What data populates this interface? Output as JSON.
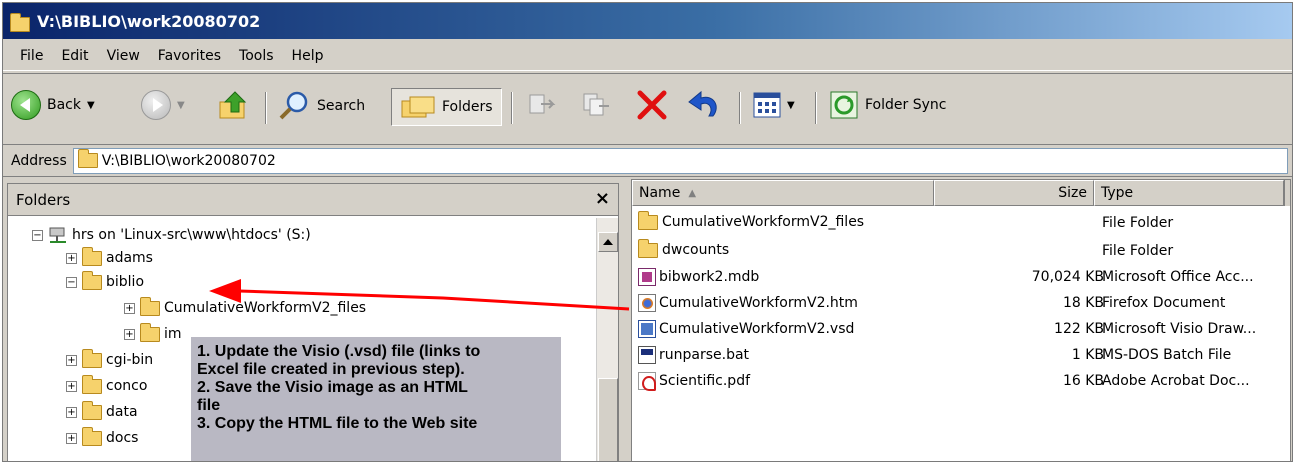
{
  "window": {
    "title": "V:\\BIBLIO\\work20080702"
  },
  "menu": {
    "items": [
      "File",
      "Edit",
      "View",
      "Favorites",
      "Tools",
      "Help"
    ]
  },
  "toolbar": {
    "back_label": "Back",
    "search_label": "Search",
    "folders_label": "Folders",
    "folder_sync_label": "Folder Sync"
  },
  "address": {
    "label": "Address",
    "value": "V:\\BIBLIO\\work20080702"
  },
  "folders_pane": {
    "title": "Folders",
    "close": "×",
    "tree": [
      {
        "label": "hrs on 'Linux-src\\www\\htdocs' (S:)",
        "expander": "−"
      },
      {
        "label": "adams",
        "expander": "+"
      },
      {
        "label": "biblio",
        "expander": "−"
      },
      {
        "label": "CumulativeWorkformV2_files",
        "expander": "+"
      },
      {
        "label": "im",
        "expander": "+"
      },
      {
        "label": "cgi-bin",
        "expander": "+"
      },
      {
        "label": "conco",
        "expander": "+"
      },
      {
        "label": "data",
        "expander": "+"
      },
      {
        "label": "docs",
        "expander": "+"
      }
    ]
  },
  "annotation": {
    "lines": [
      "1. Update the Visio (.vsd) file (links to",
      "Excel file created in previous step).",
      "2. Save the Visio image as an HTML",
      "file",
      "3. Copy the HTML file to the Web site"
    ],
    "arrow_color": "#ff0000"
  },
  "file_list": {
    "columns": {
      "name": "Name",
      "sort_indicator": "▲",
      "size": "Size",
      "type": "Type"
    },
    "rows": [
      {
        "name": "CumulativeWorkformV2_files",
        "size": "",
        "type": "File Folder",
        "icon": "folder-icon"
      },
      {
        "name": "dwcounts",
        "size": "",
        "type": "File Folder",
        "icon": "folder-icon"
      },
      {
        "name": "bibwork2.mdb",
        "size": "70,024 KB",
        "type": "Microsoft Office Acc...",
        "icon": "access-db-icon"
      },
      {
        "name": "CumulativeWorkformV2.htm",
        "size": "18 KB",
        "type": "Firefox Document",
        "icon": "html-document-icon"
      },
      {
        "name": "CumulativeWorkformV2.vsd",
        "size": "122 KB",
        "type": "Microsoft Visio Draw...",
        "icon": "visio-file-icon"
      },
      {
        "name": "runparse.bat",
        "size": "1 KB",
        "type": "MS-DOS Batch File",
        "icon": "batch-file-icon"
      },
      {
        "name": "Scientific.pdf",
        "size": "16 KB",
        "type": "Adobe Acrobat Doc...",
        "icon": "pdf-file-icon"
      }
    ]
  }
}
